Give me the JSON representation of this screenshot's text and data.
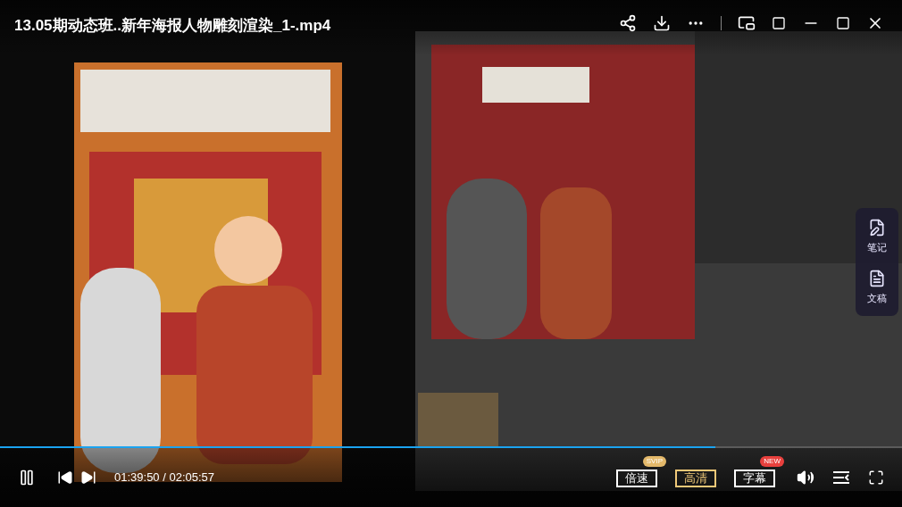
{
  "title": "13.05期动态班..新年海报人物雕刻渲染_1-.mp4",
  "side_panel": [
    {
      "kind": "notes",
      "label": "笔记"
    },
    {
      "kind": "script",
      "label": "文稿"
    }
  ],
  "progress": {
    "level": 0.793
  },
  "playback": {
    "playing": true,
    "time": "01:39:50 / 02:05:57"
  },
  "buttons": [
    {
      "label": "倍速",
      "badge": "SVIP",
      "highlighted": false
    },
    {
      "label": "高清",
      "highlighted": true
    },
    {
      "label": "字幕",
      "badge": "NEW",
      "highlighted": false
    }
  ]
}
